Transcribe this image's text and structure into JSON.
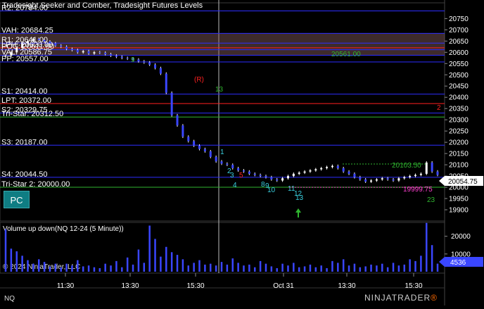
{
  "chart": {
    "title": "Tradesight Seeker and Comber, Tradesight Futures Levels",
    "symbol_label": "NQ",
    "logo": "NINJATRADER",
    "logo_mark": "®",
    "copyright": "© 2024 NinjaTrader, LLC",
    "pc_button": "PC",
    "volume_title": "Volume up down(NQ 12-24 (5 Minute))",
    "last_price": "20054.75",
    "last_volume": "4536",
    "seeker_marks": [
      {
        "text": "9",
        "color": "#2fb52f"
      },
      {
        "text": "(R)",
        "color": "#ff2020"
      },
      {
        "text": "13",
        "color": "#2fb52f"
      },
      {
        "text": "1",
        "color": "#3ad0e0"
      },
      {
        "text": "2",
        "color": "#3ad0e0"
      },
      {
        "text": "3",
        "color": "#3ad0e0"
      },
      {
        "text": "4",
        "color": "#3ad0e0"
      },
      {
        "text": "5",
        "color": "#ff2020"
      },
      {
        "text": "8",
        "color": "#3ad0e0"
      },
      {
        "text": "9",
        "color": "#3ad0e0"
      },
      {
        "text": "10",
        "color": "#3ad0e0"
      },
      {
        "text": "11",
        "color": "#3ad0e0"
      },
      {
        "text": "12",
        "color": "#3ad0e0"
      },
      {
        "text": "13",
        "color": "#3ad0e0"
      },
      {
        "text": "23",
        "color": "#2fb52f"
      }
    ],
    "price_annotations": [
      {
        "text": "20103.50",
        "color": "#2fb52f"
      },
      {
        "text": "19999.75",
        "color": "#ff3fd0"
      },
      {
        "text": "2",
        "color": "#ff2020"
      },
      {
        "text": "20561.00",
        "color": "#2fb52f"
      }
    ]
  },
  "chart_data": {
    "type": "line",
    "title": "Tradesight Seeker and Comber, Tradesight Futures Levels",
    "price_axis": {
      "min": 19850,
      "max": 20820,
      "ticks": [
        20750,
        20700,
        20650,
        20600,
        20550,
        20500,
        20450,
        20400,
        20350,
        20300,
        20250,
        20200,
        20150,
        20100,
        20050,
        20000,
        19950,
        19900
      ]
    },
    "time_axis": {
      "ticks": [
        "11:30",
        "13:30",
        "15:30",
        "Oct 31",
        "13:30",
        "15:30"
      ]
    },
    "volume_axis": {
      "min": 0,
      "max": 27000,
      "ticks": [
        20000,
        10000
      ]
    },
    "levels": [
      {
        "label": "R2: 20784.00",
        "value": 20784,
        "color": "#2d2dff"
      },
      {
        "label": "VAH: 20684.25",
        "value": 20684.25,
        "color": "#2d2dff"
      },
      {
        "label": "R1: 20641.00",
        "value": 20641,
        "color": "#2d2dff"
      },
      {
        "label": "LPH: 20620.00",
        "value": 20620,
        "color": "#ff2020"
      },
      {
        "label": "POC: 20611.50",
        "value": 20611.5,
        "color": "#2d2dff"
      },
      {
        "label": "VAL: 20586.75",
        "value": 20586.75,
        "color": "#2d2dff"
      },
      {
        "label": "PP: 20557.00",
        "value": 20557,
        "color": "#2d2dff"
      },
      {
        "label": "S1: 20414.00",
        "value": 20414,
        "color": "#2d2dff"
      },
      {
        "label": "LPT: 20372.00",
        "value": 20372,
        "color": "#ff2020"
      },
      {
        "label": "S2: 20329.75",
        "value": 20329.75,
        "color": "#2d2dff"
      },
      {
        "label": "Tri-Star: 20312.50",
        "value": 20312.5,
        "color": "#2fb52f"
      },
      {
        "label": "S3: 20187.00",
        "value": 20187,
        "color": "#2d2dff"
      },
      {
        "label": "S4: 20044.50",
        "value": 20044.5,
        "color": "#2d2dff"
      },
      {
        "label": "Tri-Star 2: 20000.00",
        "value": 20000,
        "color": "#2fb52f"
      }
    ],
    "series": [
      {
        "name": "NQ 12-24 (5 Minute)",
        "color": "#3a46ff",
        "values": [
          20585,
          20600,
          20620,
          20640,
          20650,
          20660,
          20655,
          20648,
          20640,
          20630,
          20625,
          20615,
          20610,
          20600,
          20605,
          20595,
          20600,
          20598,
          20592,
          20585,
          20580,
          20575,
          20572,
          20568,
          20560,
          20555,
          20545,
          20530,
          20505,
          20420,
          20320,
          20275,
          20225,
          20205,
          20185,
          20170,
          20160,
          20135,
          20115,
          20105,
          20100,
          20085,
          20075,
          20070,
          20060,
          20055,
          20050,
          20045,
          20035,
          20030,
          20040,
          20050,
          20060,
          20065,
          20070,
          20075,
          20080,
          20085,
          20090,
          20095,
          20085,
          20070,
          20060,
          20045,
          20035,
          20025,
          20030,
          20035,
          20040,
          20035,
          20030,
          20040,
          20045,
          20050,
          20055,
          20060,
          20110,
          20070,
          20055
        ]
      },
      {
        "name": "Volume up down",
        "color": "#3a46ff",
        "values": [
          24000,
          13000,
          11500,
          9000,
          6500,
          4500,
          7000,
          5500,
          3000,
          4500,
          2500,
          4500,
          3500,
          6500,
          3000,
          3500,
          2500,
          2000,
          4500,
          3500,
          6000,
          2500,
          8000,
          4000,
          12500,
          5000,
          26000,
          18500,
          8500,
          14000,
          11000,
          9500,
          7000,
          3500,
          5000,
          6500,
          4000,
          4500,
          3500,
          5500,
          4000,
          7500,
          5000,
          3500,
          4000,
          2500,
          6000,
          4500,
          3000,
          2000,
          4500,
          3500,
          5000,
          2500,
          3000,
          4000,
          2500,
          3500,
          2000,
          6000,
          5000,
          7000,
          3500,
          4500,
          2500,
          3000,
          4000,
          3500,
          4500,
          2500,
          5000,
          3500,
          4000,
          7000,
          6000,
          9000,
          27500,
          15000,
          4536
        ]
      }
    ]
  }
}
